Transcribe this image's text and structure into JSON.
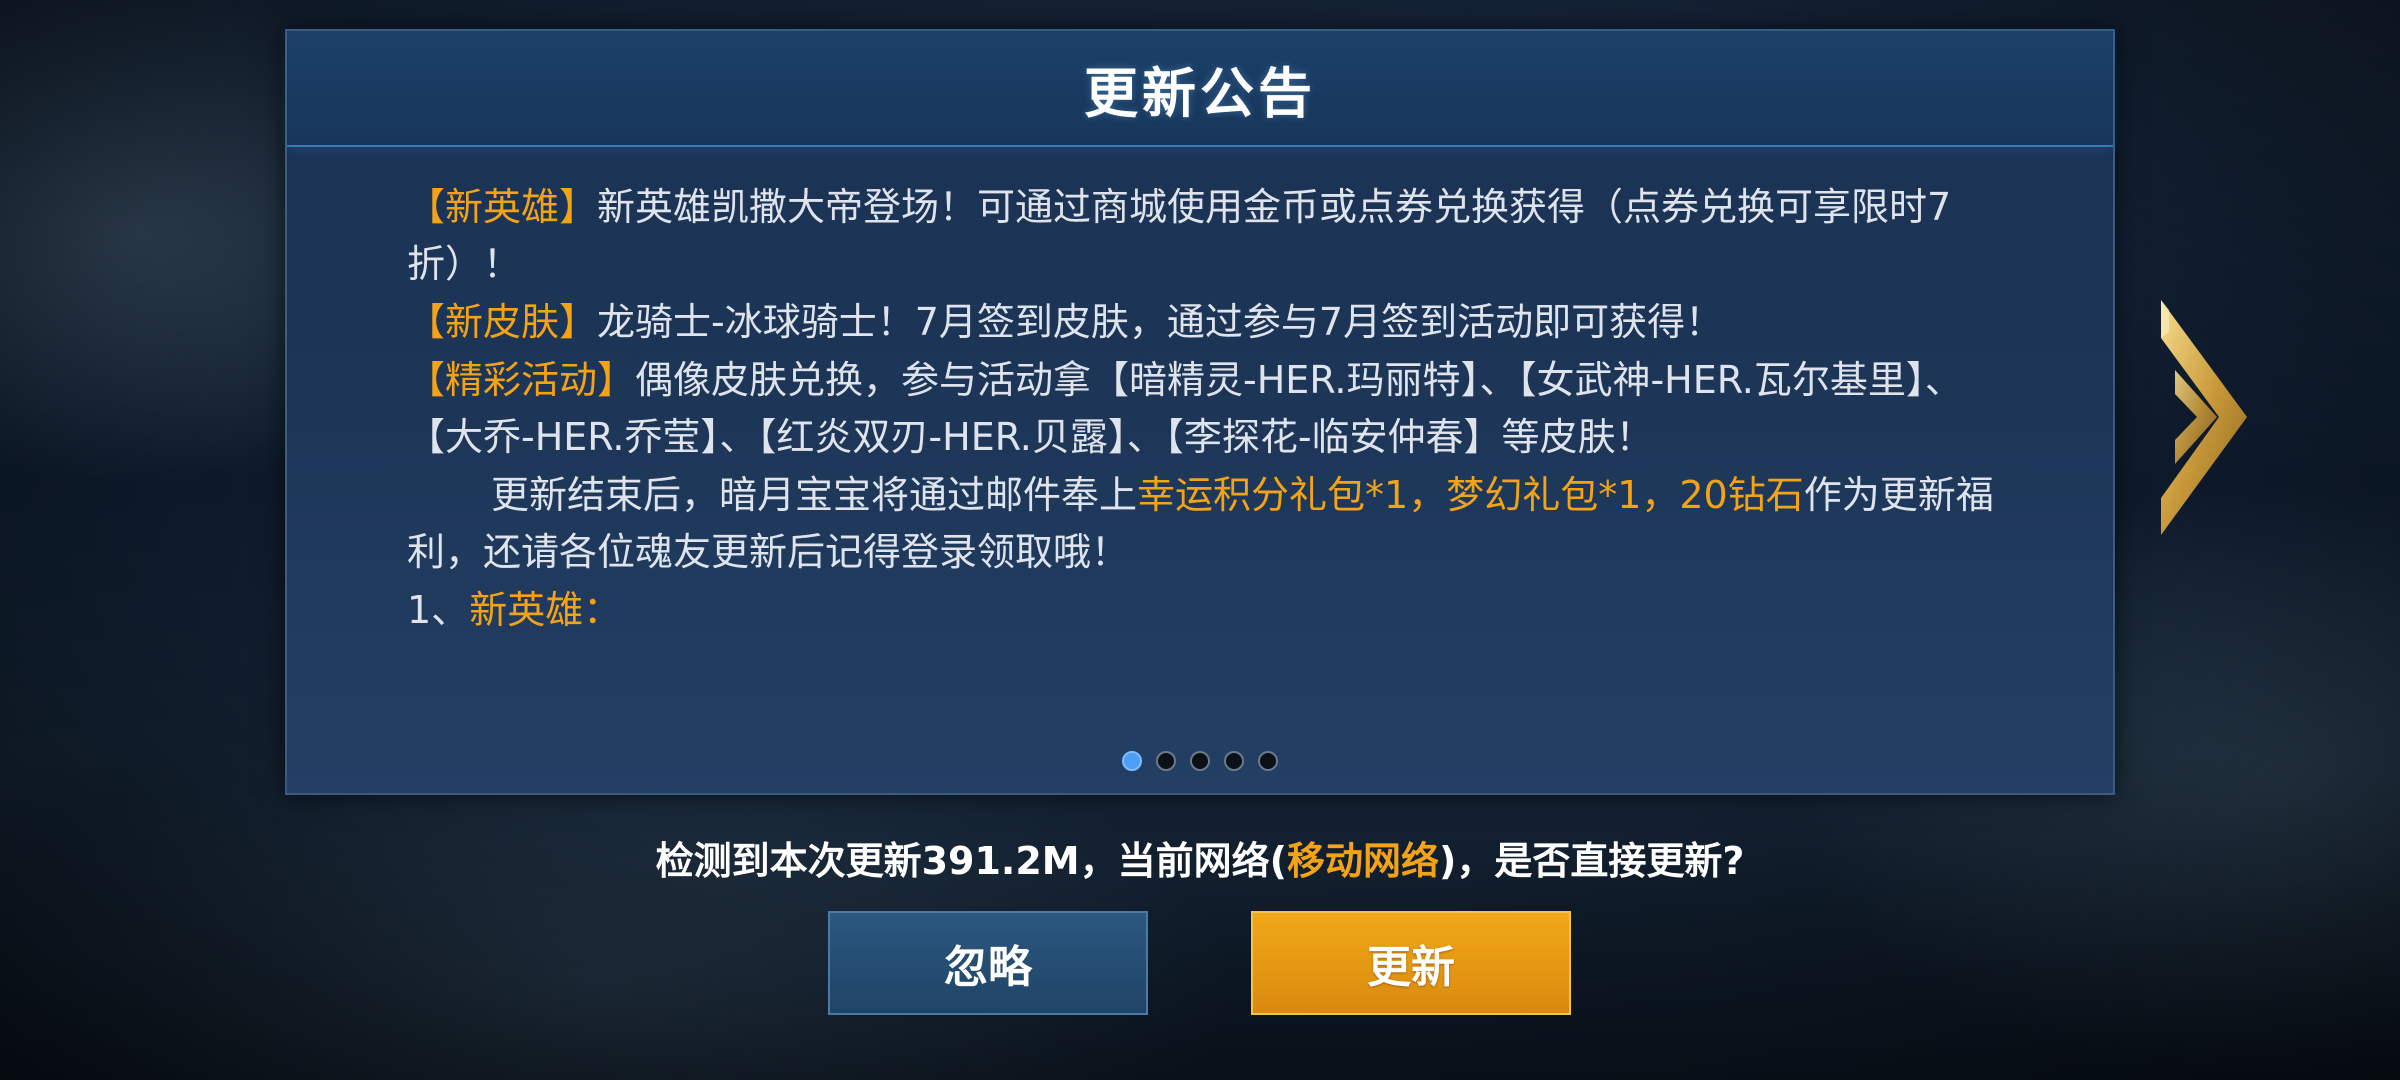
{
  "notice": {
    "title": "更新公告",
    "paragraphs": {
      "p1": {
        "tag": "【新英雄】",
        "text": "新英雄凯撒大帝登场！可通过商城使用金币或点券兑换获得（点券兑换可享限时7折）！"
      },
      "p2": {
        "tag": "【新皮肤】",
        "text": "龙骑士-冰球骑士！7月签到皮肤，通过参与7月签到活动即可获得！"
      },
      "p3": {
        "tag": "【精彩活动】",
        "text": "偶像皮肤兑换，参与活动拿【暗精灵-HER.玛丽特】、【女武神-HER.瓦尔基里】、【大乔-HER.乔莹】、【红炎双刃-HER.贝露】、【李探花-临安仲春】等皮肤！"
      },
      "p4": {
        "before": "更新结束后，暗月宝宝将通过邮件奉上",
        "highlight": "幸运积分礼包*1，梦幻礼包*1，20钻石",
        "after": "作为更新福利，还请各位魂友更新后记得登录领取哦！"
      },
      "p5": {
        "number": "1、",
        "heading": "新英雄："
      }
    },
    "pagination": {
      "pages": 5,
      "current_page": 1
    }
  },
  "prompt": {
    "before": "检测到本次更新391.2M，当前网络(",
    "network": "移动网络",
    "after": ")，是否直接更新?"
  },
  "buttons": {
    "ignore_label": "忽略",
    "update_label": "更新"
  },
  "icons": {
    "next": "chevron-right-icon"
  },
  "colors": {
    "accent": "#f3a315",
    "panel": "#1d3658",
    "active_dot": "#4d9ff3"
  }
}
